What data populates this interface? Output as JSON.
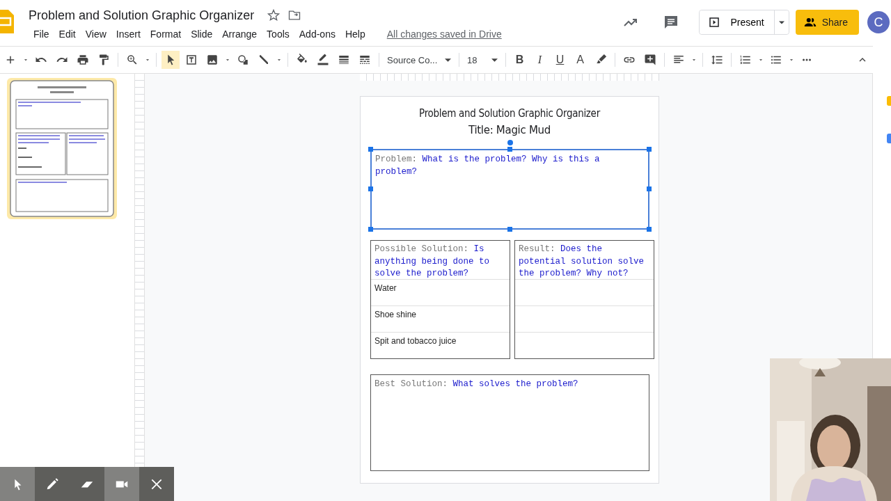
{
  "app": {
    "title": "Problem and Solution Graphic Organizer",
    "menu": [
      "File",
      "Edit",
      "View",
      "Insert",
      "Format",
      "Slide",
      "Arrange",
      "Tools",
      "Add-ons",
      "Help"
    ],
    "save_status": "All changes saved in Drive",
    "present": "Present",
    "share": "Share",
    "avatar": "C"
  },
  "toolbar": {
    "font": "Source Co...",
    "font_size": "18",
    "format_buttons": [
      "B",
      "I",
      "U",
      "A"
    ]
  },
  "thumbnail": {
    "selected": true
  },
  "slide": {
    "title": "Problem and Solution Graphic Organizer",
    "subtitle": "Title: Magic Mud",
    "problem": {
      "label": "Problem:",
      "prompt": "What is the problem? Why is this a problem?"
    },
    "possible": {
      "label": "Possible Solution:",
      "prompt": "Is anything being done to solve the problem?"
    },
    "result": {
      "label": "Result:",
      "prompt": "Does the potential solution solve the problem? Why not?"
    },
    "solutions": [
      "Water",
      "Shoe shine",
      "Spit and tobacco juice"
    ],
    "best": {
      "label": "Best Solution:",
      "prompt": "What solves the problem?"
    }
  },
  "draw_tools": [
    {
      "kind": "pointer",
      "selected": true
    },
    {
      "kind": "pen",
      "selected": false
    },
    {
      "kind": "highlighter",
      "selected": false
    },
    {
      "kind": "camera",
      "selected": true
    },
    {
      "kind": "close",
      "selected": false
    }
  ]
}
